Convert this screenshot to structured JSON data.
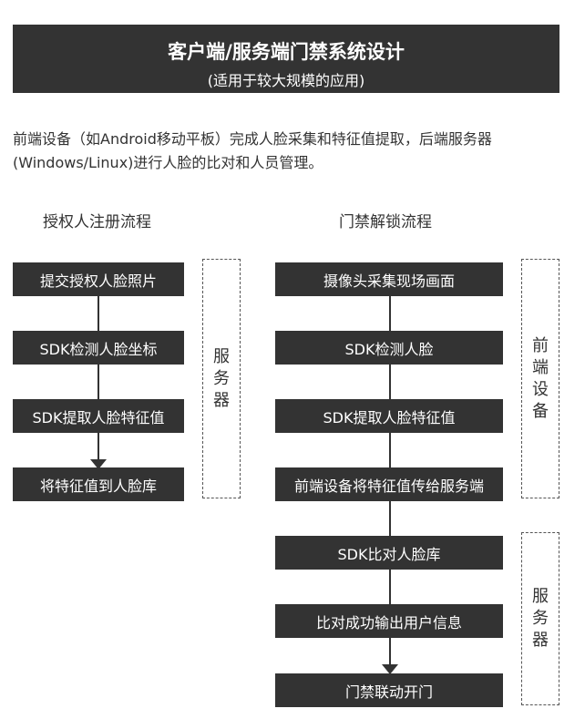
{
  "title": "客户端/服务端门禁系统设计",
  "subtitle": "(适用于较大规模的应用)",
  "description": "前端设备（如Android移动平板）完成人脸采集和特征值提取，后端服务器(Windows/Linux)进行人脸的比对和人员管理。",
  "left_flow": {
    "title": "授权人注册流程",
    "steps": [
      "提交授权人脸照片",
      "SDK检测人脸坐标",
      "SDK提取人脸特征值",
      "将特征值到人脸库"
    ],
    "group_label": [
      "服",
      "务",
      "器"
    ]
  },
  "right_flow": {
    "title": "门禁解锁流程",
    "steps": [
      "摄像头采集现场画面",
      "SDK检测人脸",
      "SDK提取人脸特征值",
      "前端设备将特征值传给服务端",
      "SDK比对人脸库",
      "比对成功输出用户信息",
      "门禁联动开门"
    ],
    "group_front_label": [
      "前",
      "端",
      "设",
      "备"
    ],
    "group_server_label": [
      "服",
      "务",
      "器"
    ]
  }
}
